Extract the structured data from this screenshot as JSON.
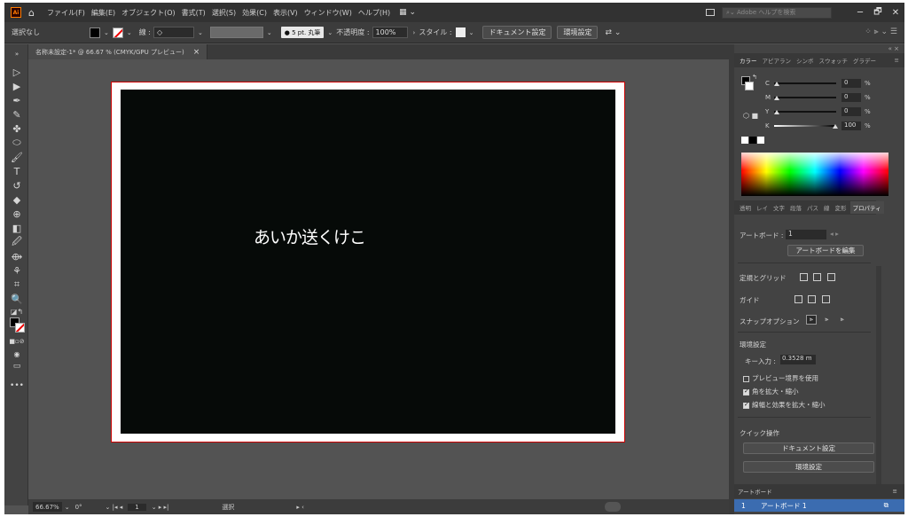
{
  "menubar": {
    "app_logo": "Ai",
    "items": [
      "ファイル(F)",
      "編集(E)",
      "オブジェクト(O)",
      "書式(T)",
      "選択(S)",
      "効果(C)",
      "表示(V)",
      "ウィンドウ(W)",
      "ヘルプ(H)"
    ],
    "search_placeholder": "Adobe ヘルプを検索",
    "win_min": "─",
    "win_restore": "🗗",
    "win_close": "✕"
  },
  "control": {
    "selection": "選択なし",
    "stroke_label": "線 :",
    "brush_label": "● 5 pt. 丸筆",
    "opacity_label": "不透明度 :",
    "opacity_value": "100%",
    "style_label": "スタイル :",
    "doc_setup": "ドキュメント設定",
    "prefs": "環境設定"
  },
  "document": {
    "tab_title": "名称未設定-1* @ 66.67 % (CMYK/GPU プレビュー)",
    "close": "×",
    "art_text": "あいか送くけこ"
  },
  "status": {
    "zoom": "66.67%",
    "rotation": "0°",
    "artboard_num": "1",
    "mode": "選択"
  },
  "panel": {
    "color_tabs": [
      "カラー",
      "アピアラン",
      "シンボ",
      "スウォッチ",
      "グラデー"
    ],
    "cmyk": [
      {
        "ch": "C",
        "value": 0
      },
      {
        "ch": "M",
        "value": 0
      },
      {
        "ch": "Y",
        "value": 0
      },
      {
        "ch": "K",
        "value": 100
      }
    ],
    "pct": "%",
    "prop_tabs": [
      "透明",
      "レイ",
      "文字",
      "段落",
      "パス",
      "線",
      "変形",
      "プロパティ"
    ],
    "artboard_label": "アートボード :",
    "artboard_value": "1",
    "edit_artboard": "アートボードを編集",
    "rulers_grid": "定規とグリッド",
    "guides": "ガイド",
    "snap_options": "スナップオプション",
    "preferences_head": "環境設定",
    "key_input_label": "キー入力 :",
    "key_input_value": "0.3528 m",
    "preview_bounds": "プレビュー境界を使用",
    "scale_corners": "角を拡大・縮小",
    "scale_strokes": "線幅と効果を拡大・縮小",
    "quick_actions": "クイック操作",
    "doc_setup_btn": "ドキュメント設定",
    "prefs_btn": "環境設定",
    "layers_tab": "アートボード",
    "layer_row_num": "1",
    "layer_row_name": "アートボード 1"
  }
}
